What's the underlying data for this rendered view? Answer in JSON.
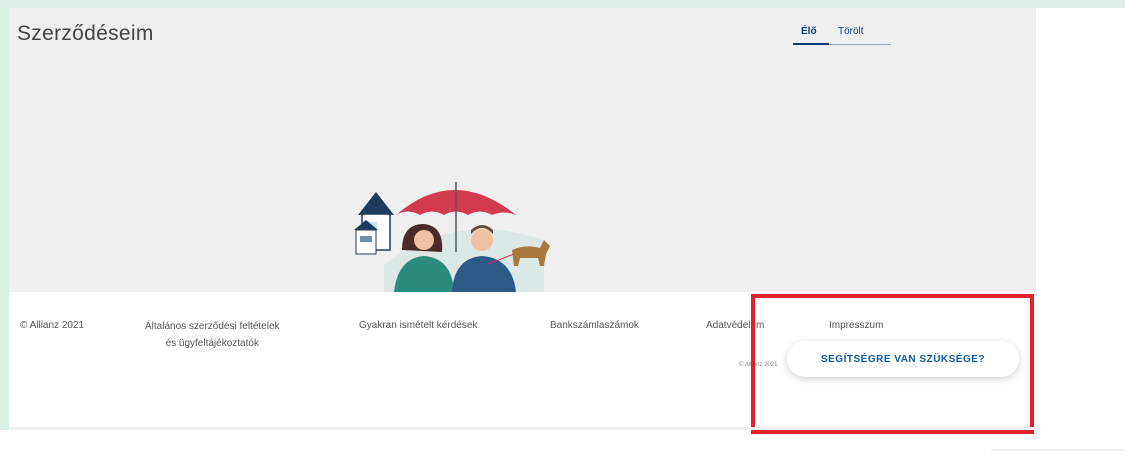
{
  "page": {
    "title": "Szerződéseim",
    "tabs": [
      {
        "label": "Élő",
        "active": true
      },
      {
        "label": "Törölt",
        "active": false
      }
    ]
  },
  "footer": {
    "copyright": "© Allianz 2021",
    "terms_line1": "Általános szerződési feltételek",
    "terms_line2": "és ügyfeltájékoztatók",
    "faq": "Gyakran ismételt kérdések",
    "bank_accounts": "Bankszámlaszámok",
    "data_protection": "Adatvédelem",
    "imprint": "Impresszum",
    "small_text": "© Allianz 2021"
  },
  "help": {
    "button_label": "SEGÍTSÉGRE VAN SZÜKSÉGE?"
  },
  "colors": {
    "accent": "#0a3d7a",
    "highlight": "#e2222a",
    "umbrella": "#d23a4f"
  },
  "icons": {
    "illustration": "family-umbrella-house-illustration"
  }
}
